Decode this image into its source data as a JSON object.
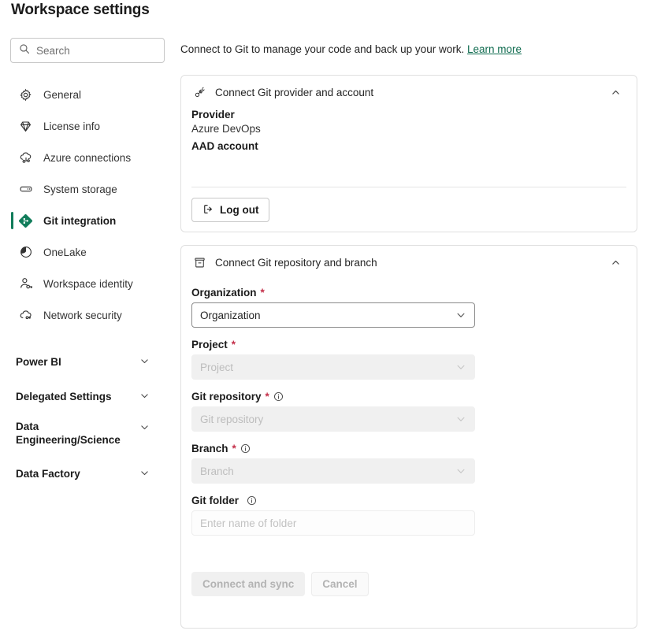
{
  "header": {
    "title": "Workspace settings"
  },
  "search": {
    "placeholder": "Search",
    "icon": "search-icon"
  },
  "sidebar": {
    "items": [
      {
        "label": "General",
        "icon": "gear-icon",
        "selected": false
      },
      {
        "label": "License info",
        "icon": "diamond-icon",
        "selected": false
      },
      {
        "label": "Azure connections",
        "icon": "cloud-link-icon",
        "selected": false
      },
      {
        "label": "System storage",
        "icon": "storage-icon",
        "selected": false
      },
      {
        "label": "Git integration",
        "icon": "git-diamond-icon",
        "selected": true
      },
      {
        "label": "OneLake",
        "icon": "onelake-icon",
        "selected": false
      },
      {
        "label": "Workspace identity",
        "icon": "identity-key-icon",
        "selected": false
      },
      {
        "label": "Network security",
        "icon": "cloud-security-icon",
        "selected": false
      }
    ],
    "groups": [
      {
        "label": "Power BI",
        "icon": "chevron-down-icon"
      },
      {
        "label": "Delegated Settings",
        "icon": "chevron-down-icon"
      },
      {
        "label": "Data Engineering/Science",
        "icon": "chevron-down-icon"
      },
      {
        "label": "Data Factory",
        "icon": "chevron-down-icon"
      }
    ]
  },
  "main": {
    "intro_text": "Connect to Git to manage your code and back up your work.",
    "intro_link": "Learn more",
    "provider_card": {
      "title": "Connect Git provider and account",
      "icon": "plug-connector-icon",
      "collapse_icon": "chevron-up-icon",
      "provider_label": "Provider",
      "provider_value": "Azure DevOps",
      "account_label": "AAD account",
      "logout_label": "Log out",
      "logout_icon": "sign-out-icon"
    },
    "repo_card": {
      "title": "Connect Git repository and branch",
      "icon": "repository-box-icon",
      "collapse_icon": "chevron-up-icon",
      "required_marker": "*",
      "fields": [
        {
          "label": "Organization",
          "value": "Organization",
          "required": true,
          "disabled": false,
          "info": false,
          "type": "select"
        },
        {
          "label": "Project",
          "value": "Project",
          "required": true,
          "disabled": true,
          "info": false,
          "type": "select"
        },
        {
          "label": "Git repository",
          "value": "Git repository",
          "required": true,
          "disabled": true,
          "info": true,
          "type": "select"
        },
        {
          "label": "Branch",
          "value": "Branch",
          "required": true,
          "disabled": true,
          "info": true,
          "type": "select"
        },
        {
          "label": "Git folder",
          "value": "Enter name of folder",
          "required": false,
          "disabled": false,
          "info": true,
          "type": "text"
        }
      ],
      "connect_label": "Connect and sync",
      "cancel_label": "Cancel"
    }
  },
  "colors": {
    "accent_green": "#107c5a",
    "link_green": "#0f6b4f",
    "required_red": "#c4314b",
    "text": "#242424",
    "card_border": "#e0e0e0"
  }
}
